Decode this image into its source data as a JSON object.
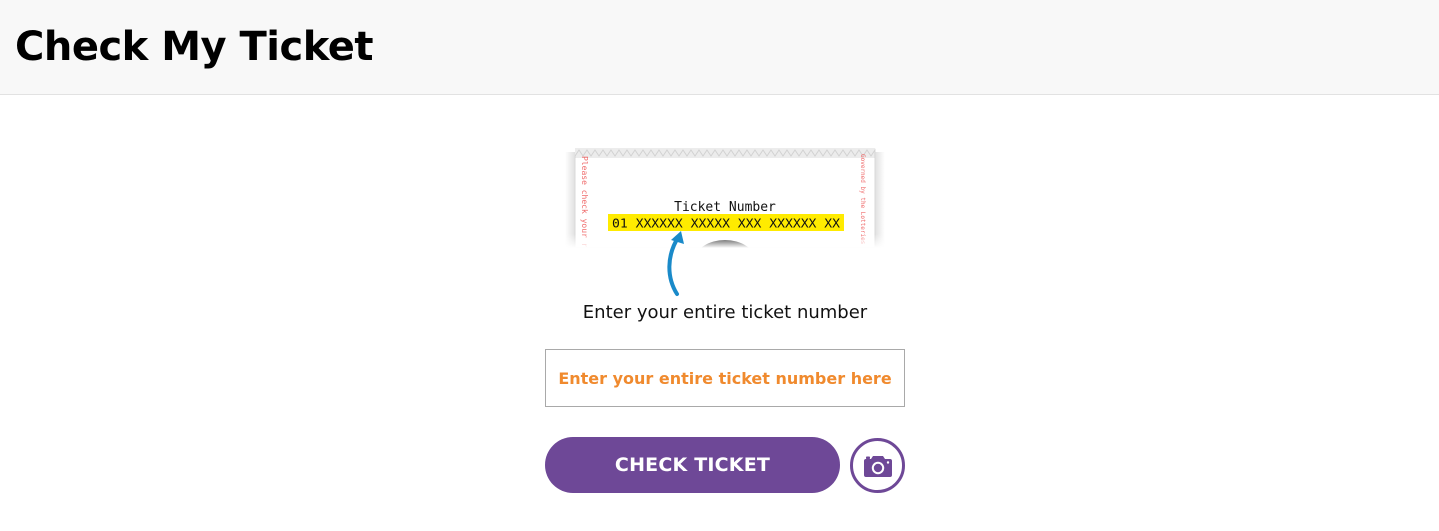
{
  "header": {
    "title": "Check My Ticket"
  },
  "illustration": {
    "heading": "Ticket Number",
    "number": "01 XXXXXX XXXXX XXX XXXXXX XX",
    "side_left": "Please check your recei",
    "side_right": "Governed by the Lotteries Act"
  },
  "form": {
    "instruction": "Enter your entire ticket number",
    "input_placeholder": "Enter your entire ticket number here",
    "input_value": "",
    "submit_label": "CHECK TICKET",
    "camera_icon": "camera-icon"
  },
  "colors": {
    "accent": "#6e4897",
    "placeholder": "#f08a2e",
    "highlight": "#ffeb00",
    "arrow": "#1a8ac9",
    "header_bg": "#f8f8f8"
  }
}
